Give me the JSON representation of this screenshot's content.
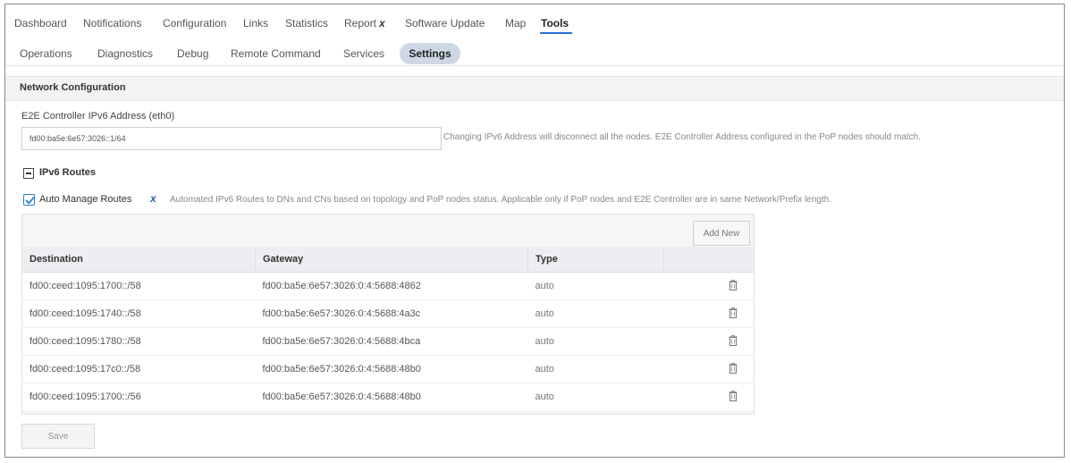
{
  "top_nav": {
    "items": [
      "Dashboard",
      "Notifications",
      "Configuration",
      "Links",
      "Statistics",
      "Report",
      "Software Update",
      "Map",
      "Tools"
    ],
    "report_close": "x",
    "active": "Tools"
  },
  "sub_nav": {
    "items": [
      "Operations",
      "Diagnostics",
      "Debug",
      "Remote Command",
      "Services"
    ],
    "active": "Settings"
  },
  "section": {
    "title": "Network Configuration"
  },
  "ipv6": {
    "label": "E2E Controller IPv6 Address (eth0)",
    "value": "fd00:ba5e:6e57:3026::1/64",
    "help": "Changing IPv6 Address will disconnect all the nodes. E2E Controller Address configured in the PoP nodes should match."
  },
  "routes": {
    "title": "IPv6 Routes",
    "auto_label": "Auto Manage Routes",
    "auto_x": "x",
    "auto_checked": true,
    "auto_desc": "Automated IPv6 Routes to DNs and CNs based on topology and PoP nodes status. Applicable only if PoP nodes and E2E Controller are in same Network/Prefix length.",
    "add_new": "Add New",
    "columns": [
      "Destination",
      "Gateway",
      "Type"
    ],
    "rows": [
      {
        "destination": "fd00:ceed:1095:1700::/58",
        "gateway": "fd00:ba5e:6e57:3026:0:4:5688:4862",
        "type": "auto"
      },
      {
        "destination": "fd00:ceed:1095:1740::/58",
        "gateway": "fd00:ba5e:6e57:3026:0:4:5688:4a3c",
        "type": "auto"
      },
      {
        "destination": "fd00:ceed:1095:1780::/58",
        "gateway": "fd00:ba5e:6e57:3026:0:4:5688:4bca",
        "type": "auto"
      },
      {
        "destination": "fd00:ceed:1095:17c0::/58",
        "gateway": "fd00:ba5e:6e57:3026:0:4:5688:48b0",
        "type": "auto"
      },
      {
        "destination": "fd00:ceed:1095:1700::/56",
        "gateway": "fd00:ba5e:6e57:3026:0:4:5688:48b0",
        "type": "auto"
      }
    ]
  },
  "save_label": "Save",
  "colors": {
    "accent": "#2b6fd6",
    "active_pill": "#cdd8e4",
    "header_bg": "#f1f3f5"
  },
  "icons": {
    "trash": "trash-icon",
    "check": "checkmark-icon",
    "collapse": "minus-square-icon"
  }
}
